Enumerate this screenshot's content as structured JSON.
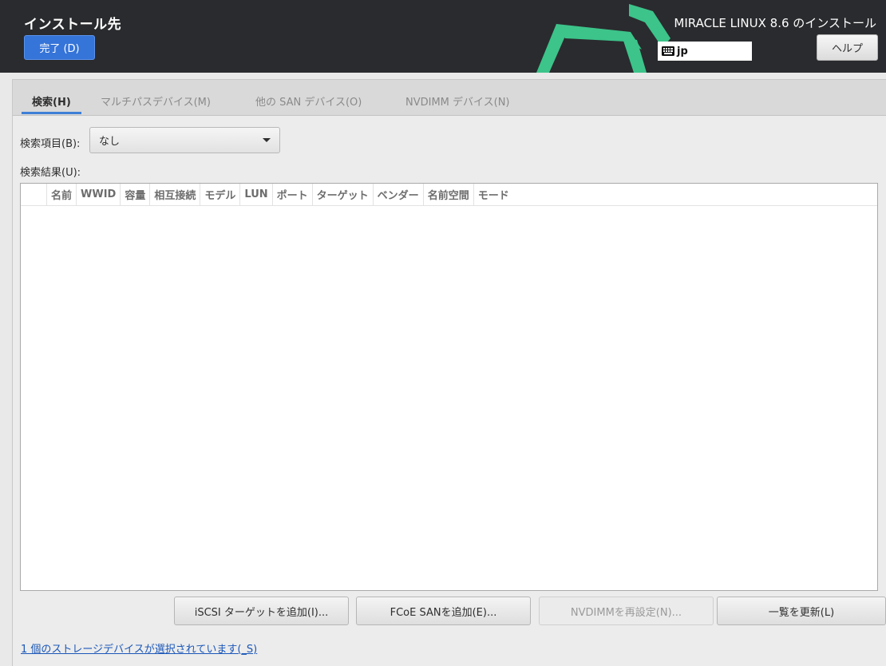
{
  "header": {
    "page_title": "インストール先",
    "done_button": "完了 (D)",
    "product_title": "MIRACLE LINUX 8.6 のインストール",
    "keyboard_layout": "jp",
    "help_button": "ヘルプ",
    "accent_color": "#3cc48a",
    "background_color": "#2a2b2e"
  },
  "tabs": [
    {
      "label": "検索(H)",
      "active": true
    },
    {
      "label": "マルチパスデバイス(M)",
      "active": false
    },
    {
      "label": "他の SAN デバイス(O)",
      "active": false
    },
    {
      "label": "NVDIMM デバイス(N)",
      "active": false
    }
  ],
  "search": {
    "label": "検索項目(B):",
    "selected": "なし"
  },
  "results": {
    "label": "検索結果(U):",
    "columns": [
      "名前",
      "WWID",
      "容量",
      "相互接続",
      "モデル",
      "LUN",
      "ポート",
      "ターゲット",
      "ベンダー",
      "名前空間",
      "モード"
    ],
    "rows": []
  },
  "buttons": {
    "add_iscsi": "iSCSI ターゲットを追加(I)...",
    "add_fcoe": "FCoE SANを追加(E)...",
    "reconfigure_nvdimm": "NVDIMMを再設定(N)...",
    "refresh_list": "一覧を更新(L)"
  },
  "status": {
    "selected_devices": "1 個のストレージデバイスが選択されています(_S)"
  }
}
